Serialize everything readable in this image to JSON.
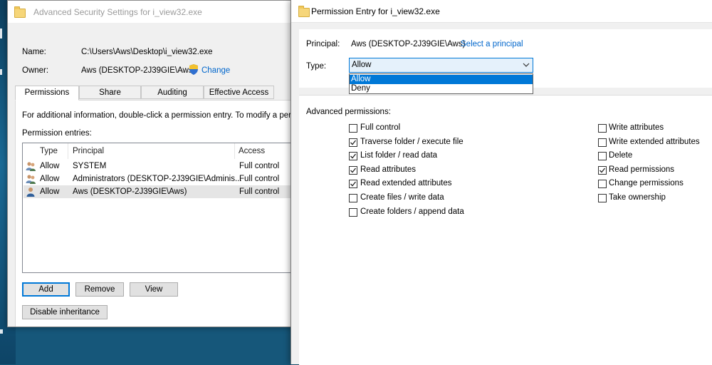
{
  "win1": {
    "title": "Advanced Security Settings for i_view32.exe",
    "name_label": "Name:",
    "name_value": "C:\\Users\\Aws\\Desktop\\i_view32.exe",
    "owner_label": "Owner:",
    "owner_value": "Aws (DESKTOP-2J39GIE\\Aws)",
    "change_link": "Change",
    "tabs": [
      "Permissions",
      "Share",
      "Auditing",
      "Effective Access"
    ],
    "info_text": "For additional information, double-click a permission entry. To modify a perm",
    "entries_label": "Permission entries:",
    "columns": [
      "Type",
      "Principal",
      "Access"
    ],
    "rows": [
      {
        "type": "Allow",
        "principal": "SYSTEM",
        "access": "Full control"
      },
      {
        "type": "Allow",
        "principal": "Administrators (DESKTOP-2J39GIE\\Adminis...",
        "access": "Full control"
      },
      {
        "type": "Allow",
        "principal": "Aws (DESKTOP-2J39GIE\\Aws)",
        "access": "Full control"
      }
    ],
    "buttons": {
      "add": "Add",
      "remove": "Remove",
      "view": "View",
      "disable_inheritance": "Disable inheritance"
    }
  },
  "win2": {
    "title": "Permission Entry for i_view32.exe",
    "principal_label": "Principal:",
    "principal_value": "Aws (DESKTOP-2J39GIE\\Aws)",
    "select_principal": "Select a principal",
    "type_label": "Type:",
    "type_value": "Allow",
    "type_options": [
      "Allow",
      "Deny"
    ],
    "advanced_label": "Advanced permissions:",
    "perms_left": [
      {
        "label": "Full control",
        "checked": false
      },
      {
        "label": "Traverse folder / execute file",
        "checked": true
      },
      {
        "label": "List folder / read data",
        "checked": true
      },
      {
        "label": "Read attributes",
        "checked": true
      },
      {
        "label": "Read extended attributes",
        "checked": true
      },
      {
        "label": "Create files / write data",
        "checked": false
      },
      {
        "label": "Create folders / append data",
        "checked": false
      }
    ],
    "perms_right": [
      {
        "label": "Write attributes",
        "checked": false
      },
      {
        "label": "Write extended attributes",
        "checked": false
      },
      {
        "label": "Delete",
        "checked": false
      },
      {
        "label": "Read permissions",
        "checked": true
      },
      {
        "label": "Change permissions",
        "checked": false
      },
      {
        "label": "Take ownership",
        "checked": false
      }
    ]
  },
  "colors": {
    "link": "#0066cc",
    "accent": "#0078d7",
    "selection": "#e5e5e5"
  },
  "icons": [
    "folder-icon",
    "shield-icon",
    "users-group-icon",
    "user-icon",
    "chevron-down-icon",
    "checkmark-icon"
  ]
}
